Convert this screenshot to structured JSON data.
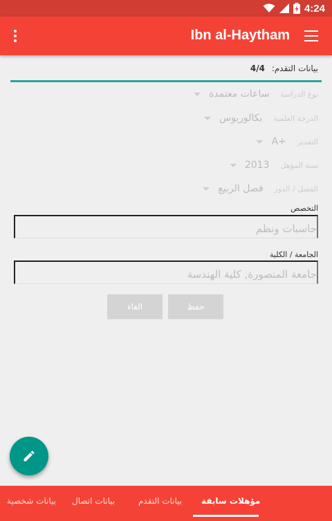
{
  "status_bar": {
    "time": "4:24"
  },
  "app_bar": {
    "title": "Ibn al-Haytham"
  },
  "progress": {
    "label": "بيانات التقدم:",
    "step": "4/4"
  },
  "fields": [
    {
      "label": "نوع الدراسة",
      "value": "ساعات معتمدة"
    },
    {
      "label": "الدرجة العلمية",
      "value": "بكالوريوس"
    },
    {
      "label": "التقدير",
      "value": "A+"
    },
    {
      "label": "سنة المؤهل",
      "value": "2013"
    },
    {
      "label": "الفصل / الدور",
      "value": "فصل الربيع"
    }
  ],
  "specialization": {
    "label": "التخصص",
    "value": "حاسبات ونظم"
  },
  "university": {
    "label": "الجامعة / الكلية",
    "value": "جامعة المنصورة, كلية الهندسة"
  },
  "actions": {
    "save": "حفظ",
    "cancel": "الغاء"
  },
  "tabs": [
    {
      "label": "مؤهلات سابقة",
      "active": true
    },
    {
      "label": "بيانات التقدم",
      "active": false
    },
    {
      "label": "بيانات اتصال",
      "active": false
    },
    {
      "label": "بيانات شخصية",
      "active": false
    }
  ],
  "colors": {
    "primary": "#f44336",
    "primary_dark": "#d13d32",
    "accent": "#009688"
  },
  "icons": [
    "wifi-icon",
    "signal-icon",
    "battery-charging-icon",
    "overflow-menu-icon",
    "hamburger-menu-icon",
    "edit-pencil-icon",
    "dropdown-caret-icon"
  ]
}
